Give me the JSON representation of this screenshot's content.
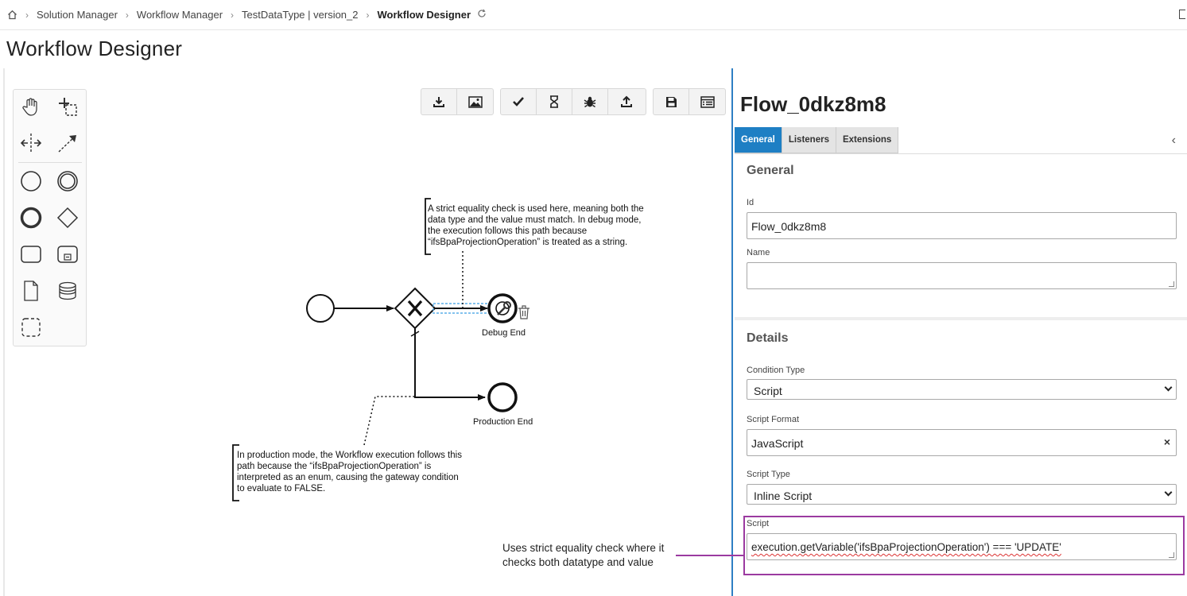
{
  "breadcrumb": {
    "items": [
      "Solution Manager",
      "Workflow Manager",
      "TestDataType | version_2"
    ],
    "current": "Workflow Designer"
  },
  "page_title": "Workflow Designer",
  "palette": {
    "tools": [
      "hand-tool-icon",
      "lasso-tool-icon",
      "space-tool-icon",
      "connect-tool-icon",
      "start-event-icon",
      "intermediate-event-icon",
      "end-event-icon",
      "gateway-icon",
      "task-icon",
      "subprocess-icon",
      "data-object-icon",
      "data-store-icon",
      "group-icon"
    ]
  },
  "toolbar": {
    "groups": [
      [
        "download-icon",
        "image-icon"
      ],
      [
        "validate-check-icon",
        "hourglass-icon",
        "debug-bug-icon",
        "upload-icon"
      ],
      [
        "save-icon",
        "properties-list-icon"
      ]
    ]
  },
  "diagram": {
    "debug_end_label": "Debug End",
    "production_end_label": "Production End",
    "annotation_top": [
      "A strict equality check is used here, meaning both the",
      "data type and the value must match. In debug mode,",
      "the execution follows this path because",
      "“ifsBpaProjectionOperation” is treated as a string."
    ],
    "annotation_bottom": [
      "In production mode, the Workflow execution follows this",
      "path because the “ifsBpaProjectionOperation” is",
      "interpreted as an enum, causing the gateway condition",
      "to evaluate to FALSE."
    ]
  },
  "panel": {
    "title": "Flow_0dkz8m8",
    "tabs": [
      "General",
      "Listeners",
      "Extensions"
    ],
    "active_tab": "General",
    "general_heading": "General",
    "id_label": "Id",
    "id_value": "Flow_0dkz8m8",
    "name_label": "Name",
    "name_value": "",
    "details_heading": "Details",
    "condition_type_label": "Condition Type",
    "condition_type_value": "Script",
    "script_format_label": "Script Format",
    "script_format_value": "JavaScript",
    "script_type_label": "Script Type",
    "script_type_value": "Inline Script",
    "script_label": "Script",
    "script_value": "execution.getVariable('ifsBpaProjectionOperation') === 'UPDATE'"
  },
  "callout": {
    "line1": "Uses strict equality check where it",
    "line2": "checks both datatype and value",
    "color": "#9b3aa0"
  },
  "colors": {
    "accent": "#1e7fc4",
    "selection": "#5aaee8"
  }
}
